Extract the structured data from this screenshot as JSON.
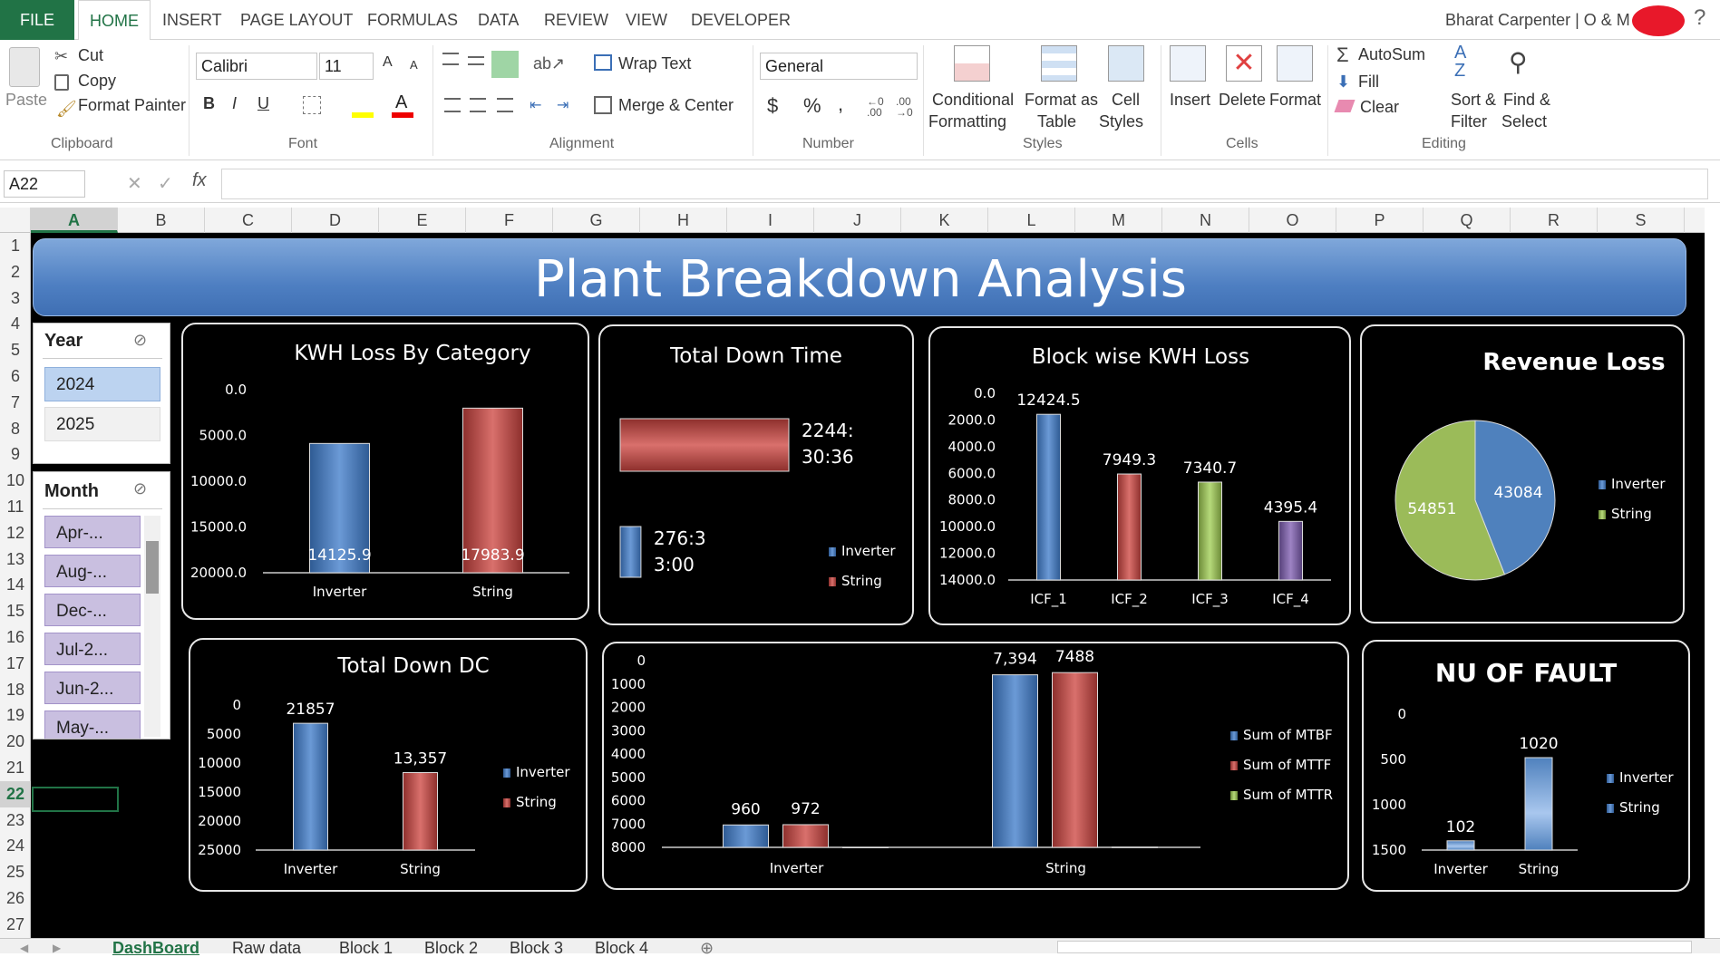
{
  "tabs": {
    "file": "FILE",
    "home": "HOME",
    "insert": "INSERT",
    "page_layout": "PAGE LAYOUT",
    "formulas": "FORMULAS",
    "data": "DATA",
    "review": "REVIEW",
    "view": "VIEW",
    "developer": "DEVELOPER",
    "user": "Bharat Carpenter | O & M"
  },
  "ribbon": {
    "clipboard": {
      "paste": "Paste",
      "cut": "Cut",
      "copy": "Copy",
      "format_painter": "Format Painter",
      "label": "Clipboard"
    },
    "font": {
      "name": "Calibri",
      "size": "11",
      "bold": "B",
      "italic": "I",
      "underline": "U",
      "label": "Font"
    },
    "alignment": {
      "wrap_text": "Wrap Text",
      "merge_center": "Merge & Center",
      "label": "Alignment"
    },
    "number": {
      "format": "General",
      "currency": "$",
      "percent": "%",
      "comma": ",",
      "label": "Number"
    },
    "styles": {
      "conditional": "Conditional",
      "conditional2": "Formatting",
      "format_as": "Format as",
      "format_as2": "Table",
      "cell": "Cell",
      "cell2": "Styles",
      "label": "Styles"
    },
    "cells": {
      "insert": "Insert",
      "delete": "Delete",
      "format": "Format",
      "label": "Cells"
    },
    "editing": {
      "autosum": "AutoSum",
      "fill": "Fill",
      "clear": "Clear",
      "sort": "Sort &",
      "sort2": "Filter",
      "find": "Find &",
      "find2": "Select",
      "label": "Editing"
    }
  },
  "formula_bar": {
    "name_box": "A22",
    "fx": "fx",
    "value": ""
  },
  "columns": [
    "A",
    "B",
    "C",
    "D",
    "E",
    "F",
    "G",
    "H",
    "I",
    "J",
    "K",
    "L",
    "M",
    "N",
    "O",
    "P",
    "Q",
    "R",
    "S"
  ],
  "rows": [
    "1",
    "2",
    "3",
    "4",
    "5",
    "6",
    "7",
    "8",
    "9",
    "10",
    "11",
    "12",
    "13",
    "14",
    "15",
    "16",
    "17",
    "18",
    "19",
    "20",
    "21",
    "22",
    "23",
    "24",
    "25",
    "26",
    "27"
  ],
  "sheet_tabs": [
    "DashBoard",
    "Raw data",
    "Block 1",
    "Block 2",
    "Block 3",
    "Block 4"
  ],
  "dashboard": {
    "title": "Plant Breakdown Analysis",
    "year_slicer": {
      "title": "Year",
      "items": [
        "2024",
        "2025"
      ]
    },
    "month_slicer": {
      "title": "Month",
      "items": [
        "Apr-...",
        "Aug-...",
        "Dec-...",
        "Jul-2...",
        "Jun-2...",
        "May-..."
      ]
    }
  },
  "colors": {
    "blue": "#4f81bd",
    "red": "#c0504d",
    "green": "#9bbb59",
    "purple": "#8064a2",
    "excel_green": "#217346"
  },
  "chart_data": [
    {
      "id": "kwh_loss",
      "type": "bar",
      "title": "KWH Loss By Category",
      "categories": [
        "Inverter",
        "String"
      ],
      "values": [
        14125.9,
        17983.9
      ],
      "labels": [
        "14125.9",
        "17983.9"
      ],
      "ylim": [
        0,
        20000
      ],
      "yticks": [
        "20000.0",
        "15000.0",
        "10000.0",
        "5000.0",
        "0.0"
      ],
      "colors": [
        "#4f81bd",
        "#c0504d"
      ],
      "grid": false
    },
    {
      "id": "down_time",
      "type": "bar",
      "orientation": "horizontal",
      "title": "Total Down Time",
      "series": [
        {
          "name": "Inverter",
          "label": "276:3 3:00",
          "label_lines": [
            "276:3",
            "3:00"
          ],
          "value_hours": 276.55
        },
        {
          "name": "String",
          "label": "2244: 30:36",
          "label_lines": [
            "2244:",
            "30:36"
          ],
          "value_hours": 2244.51
        }
      ],
      "legend": [
        "Inverter",
        "String"
      ],
      "legend_position": "right"
    },
    {
      "id": "block_kwh",
      "type": "bar",
      "title": "Block wise KWH Loss",
      "categories": [
        "ICF_1",
        "ICF_2",
        "ICF_3",
        "ICF_4"
      ],
      "values": [
        12424.5,
        7949.3,
        7340.7,
        4395.4
      ],
      "labels": [
        "12424.5",
        "7949.3",
        "7340.7",
        "4395.4"
      ],
      "ylim": [
        0,
        14000
      ],
      "yticks": [
        "14000.0",
        "12000.0",
        "10000.0",
        "8000.0",
        "6000.0",
        "4000.0",
        "2000.0",
        "0.0"
      ],
      "colors": [
        "#4f81bd",
        "#c0504d",
        "#9bbb59",
        "#8064a2"
      ],
      "grid": false
    },
    {
      "id": "revenue_loss",
      "type": "pie",
      "title": "Revenue Loss",
      "categories": [
        "Inverter",
        "String"
      ],
      "values": [
        43084,
        54851
      ],
      "labels": [
        "43084",
        "54851"
      ],
      "colors": [
        "#4f81bd",
        "#9bbb59"
      ],
      "legend_position": "right"
    },
    {
      "id": "down_dc",
      "type": "bar",
      "title": "Total Down DC",
      "categories": [
        "Inverter",
        "String"
      ],
      "values": [
        21857,
        13357
      ],
      "labels": [
        "21857",
        "13,357"
      ],
      "ylim": [
        0,
        25000
      ],
      "yticks": [
        "25000",
        "20000",
        "15000",
        "10000",
        "5000",
        "0"
      ],
      "colors": [
        "#4f81bd",
        "#c0504d"
      ],
      "legend": [
        "Inverter",
        "String"
      ],
      "legend_position": "right"
    },
    {
      "id": "mtbf",
      "type": "bar",
      "title": "",
      "categories": [
        "Inverter",
        "String"
      ],
      "series": [
        {
          "name": "Sum of MTBF",
          "values": [
            960,
            7394
          ],
          "labels": [
            "960",
            "7,394"
          ],
          "color": "#4f81bd"
        },
        {
          "name": "Sum of MTTF",
          "values": [
            972,
            7488
          ],
          "labels": [
            "972",
            "7488"
          ],
          "color": "#c0504d"
        },
        {
          "name": "Sum of MTTR",
          "values": [
            0,
            9
          ],
          "labels": [
            "",
            ""
          ],
          "color": "#9bbb59"
        }
      ],
      "ylim": [
        0,
        8000
      ],
      "yticks": [
        "8000",
        "7000",
        "6000",
        "5000",
        "4000",
        "3000",
        "2000",
        "1000",
        "0"
      ],
      "legend_position": "right"
    },
    {
      "id": "faults",
      "type": "bar",
      "title": "NU OF FAULT",
      "categories": [
        "Inverter",
        "String"
      ],
      "values": [
        102,
        1020
      ],
      "labels": [
        "102",
        "1020"
      ],
      "ylim": [
        0,
        1500
      ],
      "yticks": [
        "1500",
        "1000",
        "500",
        "0"
      ],
      "colors": [
        "#4f81bd",
        "#4f81bd"
      ],
      "legend": [
        "Inverter",
        "String"
      ],
      "legend_position": "right"
    }
  ]
}
